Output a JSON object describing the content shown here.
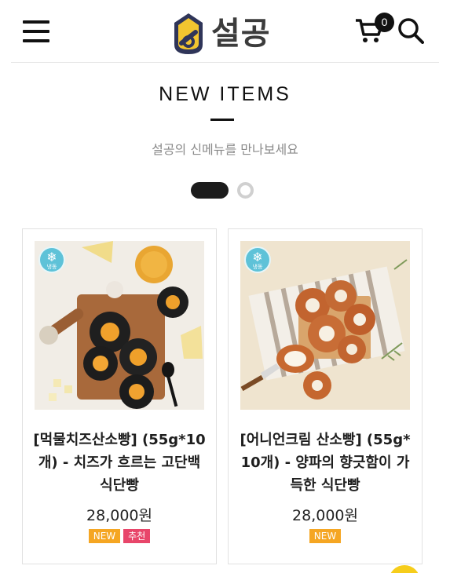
{
  "header": {
    "logo_text": "설공",
    "cart_count": "0"
  },
  "section": {
    "title": "NEW ITEMS",
    "subtitle": "설공의 신메뉴를 만나보세요"
  },
  "carousel": {
    "pages": 2,
    "active_page": 1
  },
  "products": [
    {
      "name": "[먹물치즈산소빵] (55g*10개) - 치즈가 흐르는 고단백 식단빵",
      "price": "28,000원",
      "storage_label": "냉동",
      "badges": [
        "NEW",
        "추천"
      ]
    },
    {
      "name": "[어니언크림 산소빵] (55g*10개) - 양파의 향긋함이 가득한 식단빵",
      "price": "28,000원",
      "storage_label": "냉동",
      "badges": [
        "NEW"
      ]
    }
  ],
  "colors": {
    "badge_new": "#f5a623",
    "badge_recommended": "#e8466a",
    "frozen_badge": "#5ec2d8",
    "logo_yellow": "#f2c530",
    "logo_navy": "#2f3559"
  }
}
